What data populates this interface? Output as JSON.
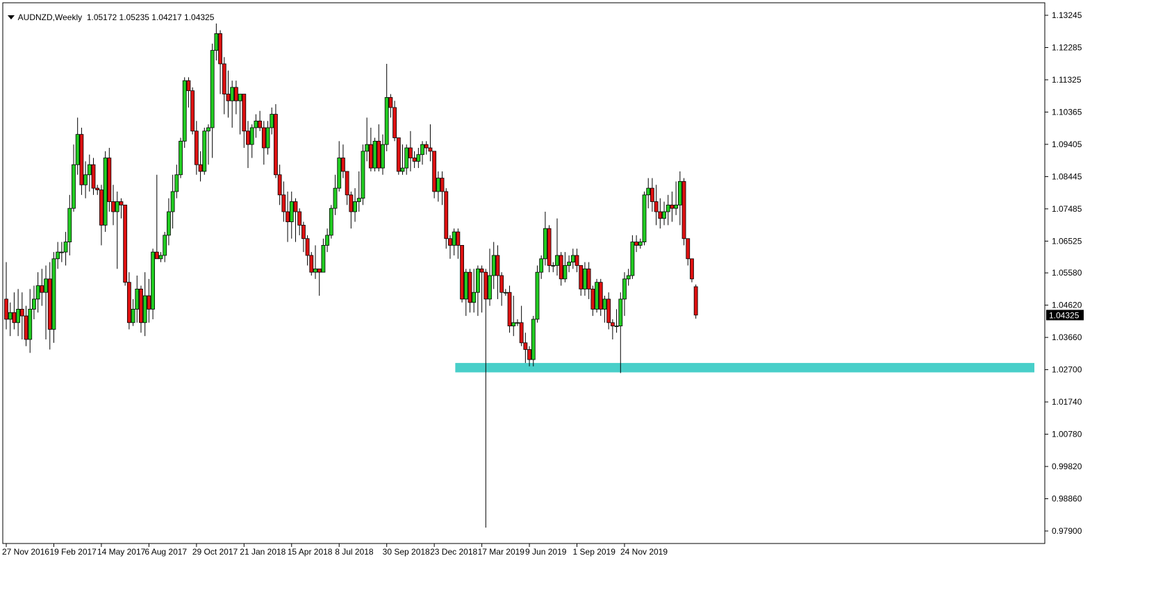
{
  "header": {
    "symbol_timeframe": "AUDNZD,Weekly",
    "open": "1.05172",
    "high": "1.05235",
    "low": "1.04217",
    "close": "1.04325"
  },
  "current_price_label": "1.04325",
  "colors": {
    "bull": "#22cc22",
    "bear": "#dd1111",
    "wick": "#000000",
    "zone": "#48cfc9",
    "axis": "#000000",
    "price_tag_bg": "#000000",
    "price_tag_text": "#ffffff"
  },
  "chart_data": {
    "type": "candlestick",
    "y_axis_ticks": [
      "1.13245",
      "1.12285",
      "1.11325",
      "1.10365",
      "1.09405",
      "1.08445",
      "1.07485",
      "1.06525",
      "1.05580",
      "1.04620",
      "1.03660",
      "1.02700",
      "1.01740",
      "1.00780",
      "0.99820",
      "0.98860",
      "0.97900"
    ],
    "x_axis_ticks": [
      "27 Nov 2016",
      "19 Feb 2017",
      "14 May 2017",
      "6 Aug 2017",
      "29 Oct 2017",
      "21 Jan 2018",
      "15 Apr 2018",
      "8 Jul 2018",
      "30 Sep 2018",
      "23 Dec 2018",
      "17 Mar 2019",
      "9 Jun 2019",
      "1 Sep 2019",
      "24 Nov 2019"
    ],
    "first_week": "27 Nov 2016",
    "ylim": [
      0.976,
      1.1335
    ],
    "support_zone": {
      "from_week": "3 Feb 2019",
      "low": 1.0262,
      "high": 1.029
    },
    "ohlc": [
      [
        1.048,
        1.059,
        1.039,
        1.042
      ],
      [
        1.042,
        1.047,
        1.037,
        1.044
      ],
      [
        1.044,
        1.05,
        1.039,
        1.041
      ],
      [
        1.041,
        1.051,
        1.037,
        1.045
      ],
      [
        1.045,
        1.05,
        1.036,
        1.043
      ],
      [
        1.043,
        1.046,
        1.034,
        1.036
      ],
      [
        1.036,
        1.051,
        1.032,
        1.045
      ],
      [
        1.045,
        1.052,
        1.042,
        1.048
      ],
      [
        1.048,
        1.056,
        1.044,
        1.052
      ],
      [
        1.052,
        1.057,
        1.046,
        1.05
      ],
      [
        1.05,
        1.058,
        1.036,
        1.054
      ],
      [
        1.054,
        1.059,
        1.033,
        1.039
      ],
      [
        1.039,
        1.062,
        1.035,
        1.06
      ],
      [
        1.06,
        1.065,
        1.057,
        1.062
      ],
      [
        1.062,
        1.065,
        1.059,
        1.062
      ],
      [
        1.062,
        1.068,
        1.058,
        1.065
      ],
      [
        1.065,
        1.079,
        1.061,
        1.075
      ],
      [
        1.075,
        1.094,
        1.074,
        1.088
      ],
      [
        1.088,
        1.102,
        1.085,
        1.097
      ],
      [
        1.097,
        1.099,
        1.079,
        1.082
      ],
      [
        1.082,
        1.089,
        1.078,
        1.085
      ],
      [
        1.085,
        1.091,
        1.08,
        1.088
      ],
      [
        1.088,
        1.09,
        1.079,
        1.081
      ],
      [
        1.081,
        1.082,
        1.079,
        1.0805
      ],
      [
        1.0805,
        1.082,
        1.064,
        1.07
      ],
      [
        1.07,
        1.092,
        1.068,
        1.09
      ],
      [
        1.09,
        1.093,
        1.074,
        1.077
      ],
      [
        1.077,
        1.082,
        1.07,
        1.074
      ],
      [
        1.074,
        1.08,
        1.057,
        1.077
      ],
      [
        1.077,
        1.078,
        1.072,
        1.076
      ],
      [
        1.076,
        1.076,
        1.052,
        1.053
      ],
      [
        1.053,
        1.056,
        1.039,
        1.041
      ],
      [
        1.041,
        1.048,
        1.04,
        1.045
      ],
      [
        1.045,
        1.055,
        1.041,
        1.051
      ],
      [
        1.051,
        1.052,
        1.038,
        1.041
      ],
      [
        1.041,
        1.056,
        1.037,
        1.049
      ],
      [
        1.049,
        1.054,
        1.041,
        1.045
      ],
      [
        1.045,
        1.063,
        1.042,
        1.062
      ],
      [
        1.062,
        1.085,
        1.06,
        1.06
      ],
      [
        1.06,
        1.062,
        1.059,
        1.061
      ],
      [
        1.061,
        1.068,
        1.059,
        1.067
      ],
      [
        1.067,
        1.078,
        1.064,
        1.074
      ],
      [
        1.074,
        1.085,
        1.069,
        1.08
      ],
      [
        1.08,
        1.088,
        1.078,
        1.085
      ],
      [
        1.085,
        1.096,
        1.084,
        1.095
      ],
      [
        1.095,
        1.114,
        1.093,
        1.113
      ],
      [
        1.113,
        1.114,
        1.105,
        1.11
      ],
      [
        1.11,
        1.111,
        1.097,
        1.098
      ],
      [
        1.098,
        1.101,
        1.085,
        1.088
      ],
      [
        1.088,
        1.092,
        1.083,
        1.086
      ],
      [
        1.086,
        1.099,
        1.085,
        1.098
      ],
      [
        1.098,
        1.1,
        1.088,
        1.099
      ],
      [
        1.099,
        1.124,
        1.09,
        1.122
      ],
      [
        1.122,
        1.13,
        1.119,
        1.127
      ],
      [
        1.127,
        1.128,
        1.109,
        1.118
      ],
      [
        1.118,
        1.12,
        1.103,
        1.109
      ],
      [
        1.109,
        1.116,
        1.102,
        1.107
      ],
      [
        1.107,
        1.113,
        1.099,
        1.111
      ],
      [
        1.111,
        1.113,
        1.103,
        1.107
      ],
      [
        1.107,
        1.109,
        1.097,
        1.109
      ],
      [
        1.109,
        1.109,
        1.093,
        1.098
      ],
      [
        1.098,
        1.101,
        1.087,
        1.094
      ],
      [
        1.094,
        1.1,
        1.09,
        1.099
      ],
      [
        1.099,
        1.103,
        1.096,
        1.101
      ],
      [
        1.101,
        1.104,
        1.098,
        1.099
      ],
      [
        1.099,
        1.101,
        1.088,
        1.093
      ],
      [
        1.093,
        1.101,
        1.091,
        1.099
      ],
      [
        1.099,
        1.105,
        1.097,
        1.103
      ],
      [
        1.103,
        1.106,
        1.084,
        1.085
      ],
      [
        1.085,
        1.088,
        1.076,
        1.079
      ],
      [
        1.079,
        1.083,
        1.071,
        1.074
      ],
      [
        1.074,
        1.08,
        1.065,
        1.071
      ],
      [
        1.071,
        1.08,
        1.066,
        1.077
      ],
      [
        1.077,
        1.078,
        1.065,
        1.074
      ],
      [
        1.074,
        1.075,
        1.067,
        1.07
      ],
      [
        1.07,
        1.071,
        1.062,
        1.066
      ],
      [
        1.066,
        1.067,
        1.058,
        1.061
      ],
      [
        1.061,
        1.062,
        1.055,
        1.056
      ],
      [
        1.056,
        1.064,
        1.054,
        1.057
      ],
      [
        1.057,
        1.057,
        1.049,
        1.056
      ],
      [
        1.056,
        1.066,
        1.056,
        1.064
      ],
      [
        1.064,
        1.069,
        1.062,
        1.067
      ],
      [
        1.067,
        1.076,
        1.066,
        1.075
      ],
      [
        1.075,
        1.085,
        1.073,
        1.081
      ],
      [
        1.081,
        1.095,
        1.08,
        1.09
      ],
      [
        1.09,
        1.094,
        1.084,
        1.086
      ],
      [
        1.086,
        1.085,
        1.076,
        1.079
      ],
      [
        1.079,
        1.08,
        1.069,
        1.074
      ],
      [
        1.074,
        1.081,
        1.071,
        1.077
      ],
      [
        1.077,
        1.086,
        1.074,
        1.078
      ],
      [
        1.078,
        1.094,
        1.076,
        1.092
      ],
      [
        1.092,
        1.102,
        1.089,
        1.094
      ],
      [
        1.094,
        1.099,
        1.086,
        1.087
      ],
      [
        1.087,
        1.096,
        1.086,
        1.095
      ],
      [
        1.095,
        1.1,
        1.086,
        1.087
      ],
      [
        1.087,
        1.097,
        1.085,
        1.094
      ],
      [
        1.094,
        1.118,
        1.092,
        1.108
      ],
      [
        1.108,
        1.109,
        1.102,
        1.105
      ],
      [
        1.105,
        1.107,
        1.095,
        1.096
      ],
      [
        1.096,
        1.096,
        1.085,
        1.086
      ],
      [
        1.086,
        1.094,
        1.085,
        1.087
      ],
      [
        1.087,
        1.094,
        1.085,
        1.093
      ],
      [
        1.093,
        1.098,
        1.086,
        1.09
      ],
      [
        1.09,
        1.092,
        1.087,
        1.089
      ],
      [
        1.089,
        1.093,
        1.087,
        1.091
      ],
      [
        1.091,
        1.095,
        1.088,
        1.094
      ],
      [
        1.094,
        1.095,
        1.091,
        1.093
      ],
      [
        1.093,
        1.1,
        1.089,
        1.092
      ],
      [
        1.092,
        1.092,
        1.078,
        1.08
      ],
      [
        1.08,
        1.086,
        1.077,
        1.084
      ],
      [
        1.084,
        1.086,
        1.076,
        1.08
      ],
      [
        1.08,
        1.081,
        1.063,
        1.066
      ],
      [
        1.066,
        1.067,
        1.06,
        1.064
      ],
      [
        1.064,
        1.069,
        1.061,
        1.068
      ],
      [
        1.068,
        1.069,
        1.06,
        1.064
      ],
      [
        1.064,
        1.064,
        1.047,
        1.048
      ],
      [
        1.048,
        1.057,
        1.043,
        1.056
      ],
      [
        1.056,
        1.057,
        1.044,
        1.047
      ],
      [
        1.047,
        1.057,
        1.044,
        1.05
      ],
      [
        1.05,
        1.058,
        1.043,
        1.057
      ],
      [
        1.057,
        1.058,
        1.044,
        1.056
      ],
      [
        1.056,
        1.057,
        0.98,
        1.048
      ],
      [
        1.048,
        1.063,
        1.046,
        1.055
      ],
      [
        1.055,
        1.065,
        1.051,
        1.061
      ],
      [
        1.061,
        1.064,
        1.048,
        1.055
      ],
      [
        1.055,
        1.056,
        1.046,
        1.05
      ],
      [
        1.05,
        1.051,
        1.049,
        1.05
      ],
      [
        1.05,
        1.052,
        1.038,
        1.04
      ],
      [
        1.04,
        1.049,
        1.037,
        1.041
      ],
      [
        1.041,
        1.042,
        1.04,
        1.041
      ],
      [
        1.041,
        1.046,
        1.034,
        1.035
      ],
      [
        1.035,
        1.038,
        1.029,
        1.033
      ],
      [
        1.033,
        1.034,
        1.028,
        1.03
      ],
      [
        1.03,
        1.043,
        1.028,
        1.042
      ],
      [
        1.042,
        1.058,
        1.041,
        1.056
      ],
      [
        1.056,
        1.061,
        1.054,
        1.06
      ],
      [
        1.06,
        1.074,
        1.058,
        1.069
      ],
      [
        1.069,
        1.07,
        1.056,
        1.058
      ],
      [
        1.058,
        1.059,
        1.056,
        1.058
      ],
      [
        1.058,
        1.072,
        1.055,
        1.061
      ],
      [
        1.061,
        1.062,
        1.052,
        1.054
      ],
      [
        1.054,
        1.062,
        1.053,
        1.058
      ],
      [
        1.058,
        1.061,
        1.056,
        1.059
      ],
      [
        1.059,
        1.063,
        1.057,
        1.061
      ],
      [
        1.061,
        1.063,
        1.056,
        1.058
      ],
      [
        1.058,
        1.058,
        1.049,
        1.051
      ],
      [
        1.051,
        1.059,
        1.049,
        1.057
      ],
      [
        1.057,
        1.059,
        1.048,
        1.051
      ],
      [
        1.051,
        1.052,
        1.043,
        1.045
      ],
      [
        1.045,
        1.054,
        1.044,
        1.053
      ],
      [
        1.053,
        1.054,
        1.043,
        1.045
      ],
      [
        1.045,
        1.049,
        1.041,
        1.048
      ],
      [
        1.048,
        1.05,
        1.039,
        1.041
      ],
      [
        1.041,
        1.042,
        1.036,
        1.04
      ],
      [
        1.04,
        1.045,
        1.038,
        1.04
      ],
      [
        1.04,
        1.05,
        1.026,
        1.048
      ],
      [
        1.048,
        1.056,
        1.043,
        1.054
      ],
      [
        1.054,
        1.057,
        1.052,
        1.055
      ],
      [
        1.055,
        1.067,
        1.054,
        1.065
      ],
      [
        1.065,
        1.067,
        1.062,
        1.064
      ],
      [
        1.064,
        1.066,
        1.063,
        1.065
      ],
      [
        1.065,
        1.08,
        1.064,
        1.079
      ],
      [
        1.079,
        1.084,
        1.075,
        1.081
      ],
      [
        1.081,
        1.084,
        1.074,
        1.077
      ],
      [
        1.077,
        1.082,
        1.07,
        1.074
      ],
      [
        1.074,
        1.078,
        1.069,
        1.072
      ],
      [
        1.072,
        1.077,
        1.07,
        1.074
      ],
      [
        1.074,
        1.079,
        1.07,
        1.076
      ],
      [
        1.076,
        1.08,
        1.071,
        1.075
      ],
      [
        1.075,
        1.083,
        1.073,
        1.076
      ],
      [
        1.076,
        1.086,
        1.07,
        1.083
      ],
      [
        1.083,
        1.084,
        1.064,
        1.066
      ],
      [
        1.066,
        1.064,
        1.058,
        1.06
      ],
      [
        1.06,
        1.06,
        1.053,
        1.054
      ],
      [
        1.0517,
        1.05235,
        1.04217,
        1.04325
      ]
    ]
  }
}
